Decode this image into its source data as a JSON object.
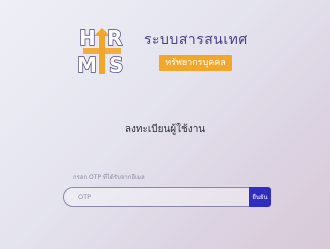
{
  "brand": {
    "title": "ระบบสารสนเทศ",
    "badge": "ทรัพยากรบุคคล",
    "logo": {
      "letters": [
        "H",
        "R",
        "M",
        "S"
      ],
      "colors": {
        "letters": "#ffffff",
        "arrow": "#f2a62a",
        "frame": "#4b3f86"
      }
    }
  },
  "page": {
    "title": "ลงทะเบียนผู้ใช้งาน"
  },
  "otp": {
    "label": "กรอก OTP ที่ได้รับจากอีเมล",
    "placeholder": "OTP",
    "value": ""
  },
  "actions": {
    "confirm_label": "ยืนยัน"
  },
  "colors": {
    "accent": "#2f2dbf",
    "brand": "#4b3f86",
    "badge": "#f2a62a"
  }
}
